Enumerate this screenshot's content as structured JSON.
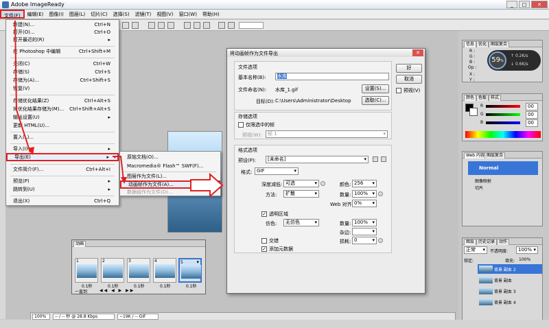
{
  "app": {
    "title": "Adobe ImageReady"
  },
  "menubar": [
    "文件(F)",
    "编辑(E)",
    "图像(I)",
    "图层(L)",
    "切片(C)",
    "选择(S)",
    "滤镜(T)",
    "视图(V)",
    "窗口(W)",
    "帮助(H)"
  ],
  "file_menu": [
    {
      "label": "新建(N)...",
      "shortcut": "Ctrl+N"
    },
    {
      "label": "打开(O)...",
      "shortcut": "Ctrl+O"
    },
    {
      "label": "打开最近的(R)",
      "shortcut": "▸"
    },
    {
      "label": "在 Photoshop 中编辑",
      "shortcut": "Ctrl+Shift+M"
    },
    {
      "label": "关闭(C)",
      "shortcut": "Ctrl+W"
    },
    {
      "label": "存储(S)",
      "shortcut": "Ctrl+S"
    },
    {
      "label": "存储为(A)...",
      "shortcut": "Ctrl+Shift+S"
    },
    {
      "label": "恢复(V)",
      "shortcut": ""
    },
    {
      "label": "存储优化结果(Z)",
      "shortcut": "Ctrl+Alt+S"
    },
    {
      "label": "将优化结果存储为(M)...",
      "shortcut": "Ctrl+Shift+Alt+S"
    },
    {
      "label": "输出设置(U)",
      "shortcut": "▸"
    },
    {
      "label": "更新 HTML(U)...",
      "shortcut": ""
    },
    {
      "label": "置入(L)...",
      "shortcut": ""
    },
    {
      "label": "导入(I)",
      "shortcut": "▸"
    },
    {
      "label": "导出(E)",
      "shortcut": "▸"
    },
    {
      "label": "文件简介(F)...",
      "shortcut": "Ctrl+Alt+I"
    },
    {
      "label": "预览(P)",
      "shortcut": "▸"
    },
    {
      "label": "跳转到(U)",
      "shortcut": "▸"
    },
    {
      "label": "退出(X)",
      "shortcut": "Ctrl+Q"
    }
  ],
  "export_submenu": [
    "原始文档(O)...",
    "Macromedia® Flash™ SWF(F)...",
    "图层作为文件(L)...",
    "动画帧作为文件(A)...",
    "数据组作为文件(D)..."
  ],
  "dialog": {
    "title": "将动画帧作为文件导出",
    "file_options": "文件选项",
    "basename_label": "基本名称(B):",
    "basename_value": "水库",
    "filename_label": "文件命名(N):",
    "filename_value": "水库_1.gif",
    "target_label": "目标(D):",
    "target_value": "C:\\Users\\Administrator\\Desktop",
    "settings_btn": "设置(S)...",
    "choose_btn": "选取(C)...",
    "ok_btn": "好",
    "cancel_btn": "取消",
    "preview_chk": "预视(V)",
    "save_options": "存储选项",
    "only_selected_chk": "仅限选中的帧",
    "preset_w_label": "预视(W):",
    "preset_w_value": "帧 1",
    "format_options": "格式选项",
    "preset_label": "预设(P):",
    "preset_value": "[未命名]",
    "format_label": "格式:",
    "format_value": "GIF",
    "reduce_label": "深度减低:",
    "reduce_value": "可选",
    "colors_label": "颜色:",
    "colors_value": "256",
    "method_label": "方法:",
    "method_value": "扩散",
    "amount_label": "数量:",
    "amount_value": "100%",
    "web_label": "Web 对齐:",
    "web_value": "0%",
    "transparency_chk": "透明区域",
    "dither_label": "仿色:",
    "dither_value": "无仿色",
    "amount2_label": "数量:",
    "amount2_value": "100%",
    "matte_label": "杂边:",
    "interlaced_chk": "交错",
    "lossy_label": "损耗:",
    "lossy_value": "0",
    "metadata_chk": "添加元数据"
  },
  "info_panel": {
    "tabs": [
      "信息",
      "优化",
      "图层复合"
    ],
    "rows": [
      "R :",
      "G :",
      "B :",
      "Op :",
      "X :",
      "Y :"
    ],
    "badge": "59",
    "badge_unit": "%",
    "speed_up": "0.2K/s",
    "speed_down": "0.6K/s"
  },
  "color_panel": {
    "tabs": [
      "颜色",
      "色板",
      "样式"
    ],
    "channels": [
      "R",
      "G",
      "B"
    ],
    "values": [
      "00",
      "00",
      "00"
    ]
  },
  "web_panel": {
    "tabs": [
      "Web 内容",
      "图层复合"
    ],
    "items": [
      "Normal",
      "图像映射",
      "切片"
    ]
  },
  "layers_panel": {
    "tabs": [
      "图层",
      "历史记录",
      "动作"
    ],
    "mode": "正常",
    "opacity_label": "不透明度:",
    "opacity_value": "100%",
    "lock_label": "锁定:",
    "fill_label": "填充:",
    "fill_value": "100%",
    "layers": [
      "背景 副本 2",
      "背景 副本",
      "背景 副本 3",
      "背景 副本 4"
    ]
  },
  "animation_panel": {
    "title": "动画",
    "frames": [
      "1",
      "2",
      "3",
      "4",
      "5"
    ],
    "times": [
      "0.1秒",
      "0.1秒",
      "0.1秒",
      "0.1秒",
      "0.1秒"
    ],
    "loop": "一直到"
  },
  "status": {
    "zoom": "100%",
    "speed": "-- / -- 秒 @ 28.8 Kbps",
    "size": "~19K / -- GIF"
  },
  "colors": {
    "accent": "#e02020",
    "selection": "#3875d7"
  }
}
